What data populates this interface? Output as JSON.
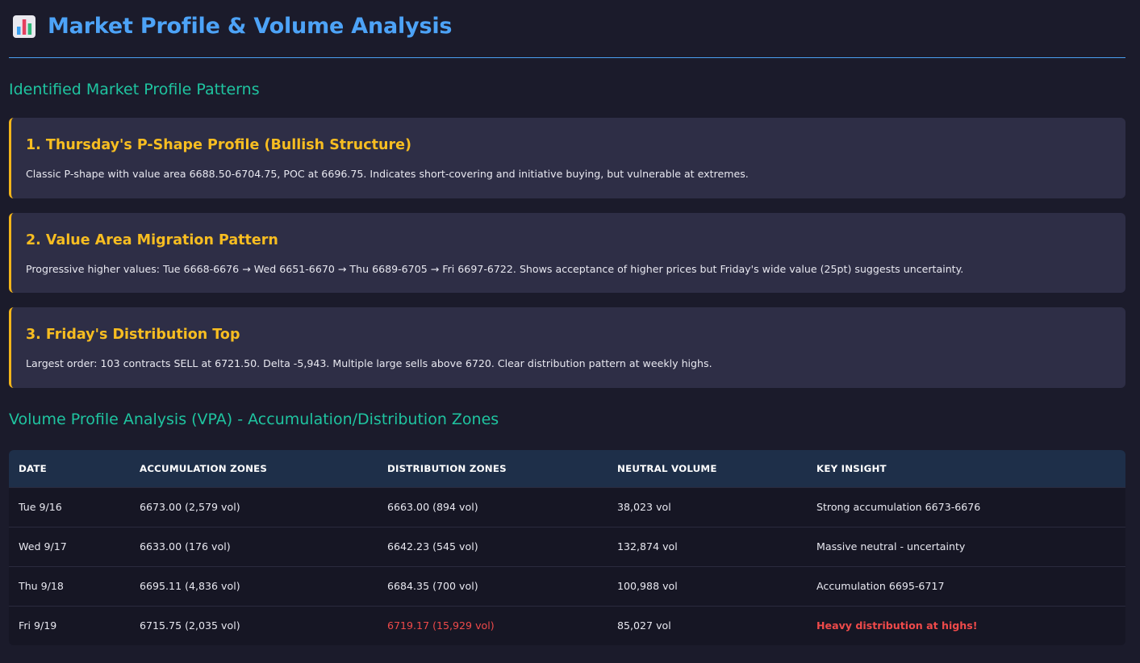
{
  "header": {
    "icon": "bar-chart-icon",
    "title": "Market Profile & Volume Analysis",
    "accent_color": "#4da3f7"
  },
  "patterns_section": {
    "title": "Identified Market Profile Patterns",
    "cards": [
      {
        "title": "1. Thursday's P-Shape Profile (Bullish Structure)",
        "text": "Classic P-shape with value area 6688.50-6704.75, POC at 6696.75. Indicates short-covering and initiative buying, but vulnerable at extremes."
      },
      {
        "title": "2. Value Area Migration Pattern",
        "text": "Progressive higher values: Tue 6668-6676 → Wed 6651-6670 → Thu 6689-6705 → Fri 6697-6722. Shows acceptance of higher prices but Friday's wide value (25pt) suggests uncertainty."
      },
      {
        "title": "3. Friday's Distribution Top",
        "text": "Largest order: 103 contracts SELL at 6721.50. Delta -5,943. Multiple large sells above 6720. Clear distribution pattern at weekly highs."
      }
    ]
  },
  "vpa_section": {
    "title": "Volume Profile Analysis (VPA) - Accumulation/Distribution Zones",
    "columns": [
      "DATE",
      "ACCUMULATION ZONES",
      "DISTRIBUTION ZONES",
      "NEUTRAL VOLUME",
      "KEY INSIGHT"
    ],
    "rows": [
      [
        "Tue 9/16",
        "6673.00 (2,579 vol)",
        "6663.00 (894 vol)",
        "38,023 vol",
        "Strong accumulation 6673-6676"
      ],
      [
        "Wed 9/17",
        "6633.00 (176 vol)",
        "6642.23 (545 vol)",
        "132,874 vol",
        "Massive neutral - uncertainty"
      ],
      [
        "Thu 9/18",
        "6695.11 (4,836 vol)",
        "6684.35 (700 vol)",
        "100,988 vol",
        "Accumulation 6695-6717"
      ],
      [
        "Fri 9/19",
        "6715.75 (2,035 vol)",
        "6719.17 (15,929 vol)",
        "85,027 vol",
        "Heavy distribution at highs!"
      ]
    ],
    "alert_color": "#ef4a4a"
  }
}
